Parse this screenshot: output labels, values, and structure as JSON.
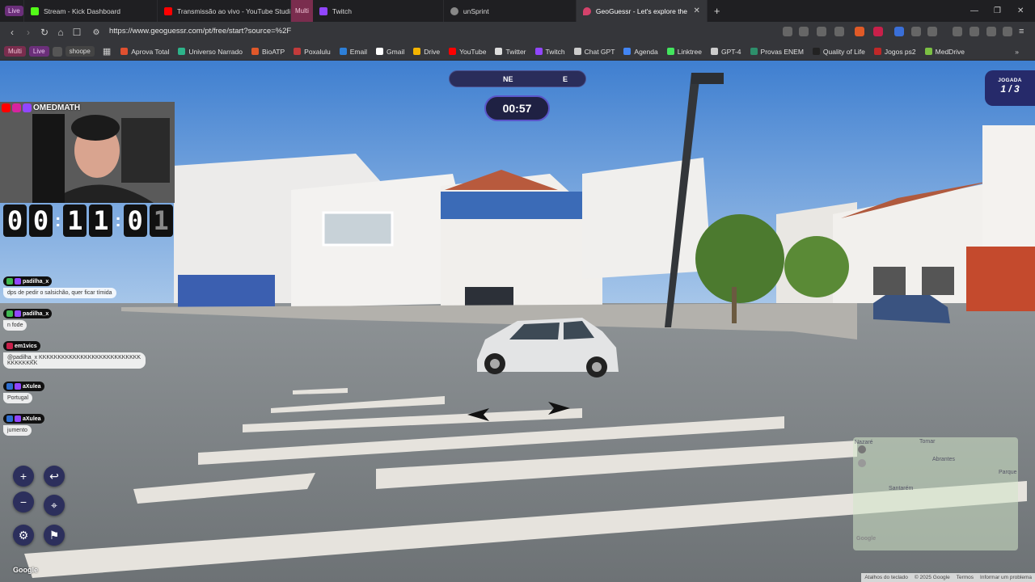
{
  "browser": {
    "tabs": [
      {
        "label": "Live",
        "type": "badge"
      },
      {
        "label": "Stream - Kick Dashboard",
        "color": "#53fc18"
      },
      {
        "label": "Transmissão ao vivo - YouTube Studio",
        "color": "#ff0000"
      },
      {
        "label": "Multi",
        "type": "badge"
      },
      {
        "label": "Twitch",
        "color": "#9146ff"
      },
      {
        "label": "unSprint",
        "color": "#888888"
      },
      {
        "label": "GeoGuessr - Let's explore the",
        "color": "#d4426b",
        "active": true
      }
    ],
    "url": "https://www.geoguessr.com/pt/free/start?source=%2F",
    "bookmark_chips": [
      "Multi",
      "Live",
      "shoope"
    ],
    "bookmarks": [
      {
        "label": "Aprova Total",
        "color": "#e05030"
      },
      {
        "label": "Universo Narrado",
        "color": "#2db38a"
      },
      {
        "label": "BioATP",
        "color": "#e0582a"
      },
      {
        "label": "Poxalulu",
        "color": "#c23b3b"
      },
      {
        "label": "Email",
        "color": "#2d7fd8"
      },
      {
        "label": "Gmail",
        "color": "#ffffff"
      },
      {
        "label": "Drive",
        "color": "#f4b400"
      },
      {
        "label": "YouTube",
        "color": "#ff0000"
      },
      {
        "label": "Twitter",
        "color": "#dddddd"
      },
      {
        "label": "Twitch",
        "color": "#9146ff"
      },
      {
        "label": "Chat GPT",
        "color": "#cccccc"
      },
      {
        "label": "Agenda",
        "color": "#4285f4"
      },
      {
        "label": "Linktree",
        "color": "#43e55e"
      },
      {
        "label": "GPT-4",
        "color": "#cccccc"
      },
      {
        "label": "Provas ENEM",
        "color": "#2d8f6b"
      },
      {
        "label": "Quality of Life",
        "color": "#222222"
      },
      {
        "label": "Jogos ps2",
        "color": "#c02828"
      },
      {
        "label": "MedDrive",
        "color": "#7bc043"
      }
    ]
  },
  "game": {
    "compass_ne": "NE",
    "compass_e": "E",
    "timer": "00:57",
    "round_label": "JOGADA",
    "round_value": "1 / 3",
    "google": "Google"
  },
  "overlay": {
    "streamer": "OMEDMATH",
    "clock_digits": [
      "0",
      "0",
      "1",
      "1",
      "0",
      "1"
    ],
    "chat": [
      {
        "user": "padilha_x",
        "text": "dps de pedir o salsichão, quer ficar tímida"
      },
      {
        "user": "padilha_x",
        "text": "n fode"
      },
      {
        "user": "em1vics",
        "text": "@padilha_x KKKKKKKKKKKKKKKKKKKKKKKKKKKKKKKKKKK"
      },
      {
        "user": "aXulea",
        "text": "Portugal"
      },
      {
        "user": "aXulea",
        "text": "jumento"
      }
    ]
  },
  "minimap": {
    "places": [
      "Nazaré",
      "Tomar",
      "Abrantes",
      "Santarém",
      "Parque",
      "Google"
    ],
    "footer": [
      "Atalhos do teclado",
      "© 2025 Google",
      "Termos",
      "Informar um problema"
    ]
  }
}
